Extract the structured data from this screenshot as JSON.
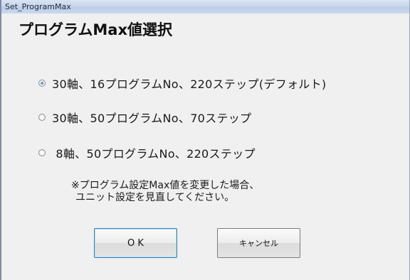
{
  "window": {
    "title": "Set_ProgramMax"
  },
  "heading": "プログラムMax値選択",
  "options": [
    {
      "label": "30軸、16プログラムNo、220ステップ(デフォルト)",
      "checked": true
    },
    {
      "label": "30軸、50プログラムNo、70ステップ",
      "checked": false
    },
    {
      "label": " 8軸、50プログラムNo、220ステップ",
      "checked": false
    }
  ],
  "note": {
    "line1": "※プログラム設定Max値を変更した場合、",
    "line2": "ユニット設定を見直してください。"
  },
  "buttons": {
    "ok": "O K",
    "cancel": "キャンセル"
  }
}
